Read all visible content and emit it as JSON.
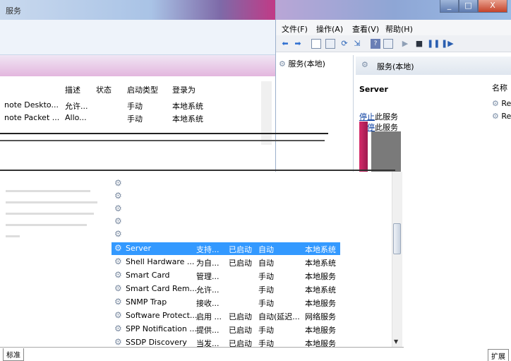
{
  "back_window": {
    "title": "服务",
    "columns": [
      "描述",
      "状态",
      "启动类型",
      "登录为"
    ],
    "rows": [
      {
        "name": "note Deskto...",
        "desc": "允许...",
        "status": "",
        "startup": "手动",
        "logon": "本地系统"
      },
      {
        "name": "note Packet ...",
        "desc": "Allo...",
        "status": "",
        "startup": "手动",
        "logon": "本地系统"
      }
    ]
  },
  "right_window": {
    "menu": [
      "文件(F)",
      "操作(A)",
      "查看(V)",
      "帮助(H)"
    ],
    "window_buttons": {
      "minimize": "_",
      "maximize": "□",
      "close": "X"
    },
    "tree_root": "服务(本地)",
    "detail_header": "服务(本地)",
    "selected_service": "Server",
    "actions": [
      {
        "link": "停止",
        "suffix": "此服务"
      },
      {
        "link": "暂停",
        "suffix": "此服务"
      }
    ],
    "name_column": "名称",
    "name_items": [
      "Re",
      "Re"
    ],
    "bottom_tab": "扩展"
  },
  "front_list": {
    "rows": [
      {
        "name": "Server",
        "desc": "支持...",
        "status": "已启动",
        "startup": "自动",
        "logon": "本地系统",
        "selected": true
      },
      {
        "name": "Shell Hardware ...",
        "desc": "为自...",
        "status": "已启动",
        "startup": "自动",
        "logon": "本地系统"
      },
      {
        "name": "Smart Card",
        "desc": "管理...",
        "status": "",
        "startup": "手动",
        "logon": "本地服务"
      },
      {
        "name": "Smart Card Rem...",
        "desc": "允许...",
        "status": "",
        "startup": "手动",
        "logon": "本地系统"
      },
      {
        "name": "SNMP Trap",
        "desc": "接收...",
        "status": "",
        "startup": "手动",
        "logon": "本地服务"
      },
      {
        "name": "Software Protect...",
        "desc": "启用 ...",
        "status": "已启动",
        "startup": "自动(延迟...",
        "logon": "网络服务"
      },
      {
        "name": "SPP Notification ...",
        "desc": "提供...",
        "status": "已启动",
        "startup": "手动",
        "logon": "本地服务"
      },
      {
        "name": "SSDP Discovery",
        "desc": "当发...",
        "status": "已启动",
        "startup": "手动",
        "logon": "本地服务"
      }
    ],
    "bottom_tab": "标准"
  }
}
